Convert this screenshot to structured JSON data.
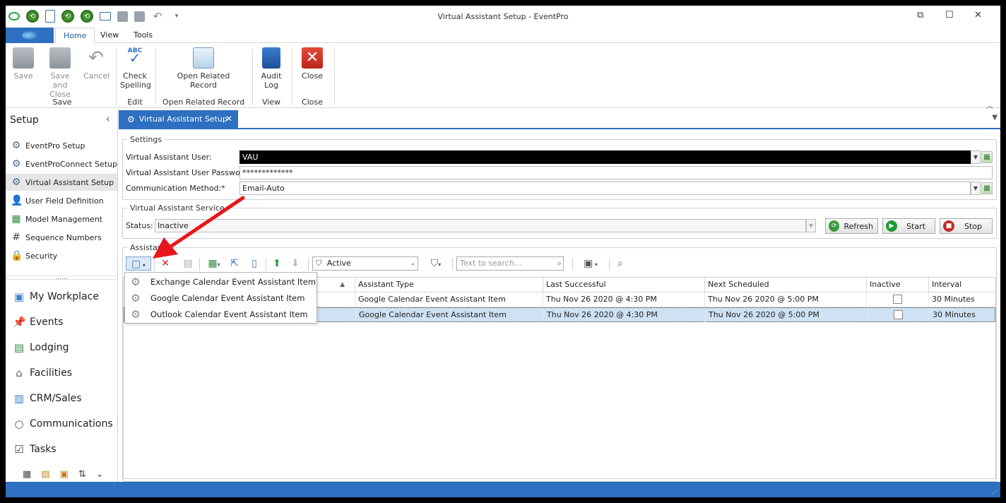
{
  "window": {
    "title": "Virtual Assistant Setup - EventPro"
  },
  "ribbon": {
    "tabs": [
      "Home",
      "View",
      "Tools"
    ],
    "buttons": {
      "save": "Save",
      "save_close": "Save and\nClose",
      "cancel": "Cancel",
      "check_spelling": "Check\nSpelling",
      "open_related": "Open Related\nRecord",
      "audit_log": "Audit\nLog",
      "close": "Close"
    },
    "groups": {
      "save": "Save",
      "edit": "Edit",
      "open_related": "Open Related Record",
      "view": "View",
      "close": "Close"
    },
    "check_icon_text": "ABC"
  },
  "sidebar": {
    "header": "Setup",
    "items": [
      "EventPro Setup",
      "EventProConnect Setup",
      "Virtual Assistant Setup",
      "User Field Definition",
      "Model Management",
      "Sequence Numbers",
      "Security"
    ],
    "splitter": "......",
    "nav": [
      "My Workplace",
      "Events",
      "Lodging",
      "Facilities",
      "CRM/Sales",
      "Communications",
      "Tasks"
    ]
  },
  "doc_tab": {
    "label": "Virtual Assistant Setup"
  },
  "settings": {
    "legend": "Settings",
    "user_label": "Virtual Assistant User:",
    "user_value": "VAU",
    "password_label": "Virtual Assistant User Password:",
    "password_value": "*************",
    "method_label": "Communication Method:*",
    "method_value": "Email-Auto"
  },
  "service": {
    "legend": "Virtual Assistant Service",
    "status_label": "Status:",
    "status_value": "Inactive",
    "refresh": "Refresh",
    "start": "Start",
    "stop": "Stop"
  },
  "assistants": {
    "legend": "Assistants",
    "filter_value": "Active",
    "search_placeholder": "Text to search...",
    "columns": [
      "Assistant Type",
      "Last Successful",
      "Next Scheduled",
      "Inactive",
      "Interval"
    ],
    "rows": [
      {
        "type": "Google Calendar Event Assistant Item",
        "last": "Thu Nov 26 2020 @ 4:30 PM",
        "next": "Thu Nov 26 2020 @ 5:00 PM",
        "interval": "30 Minutes"
      },
      {
        "type": "Google Calendar Event Assistant Item",
        "last": "Thu Nov 26 2020 @ 4:30 PM",
        "next": "Thu Nov 26 2020 @ 5:00 PM",
        "interval": "30 Minutes"
      }
    ],
    "new_menu": [
      "Exchange Calendar Event Assistant Item",
      "Google Calendar Event Assistant Item",
      "Outlook Calendar Event Assistant Item"
    ]
  },
  "colors": {
    "accent": "#2d6fc0",
    "arrow": "#e8161b",
    "selected_row": "#cfe2f3"
  },
  "icons": [
    "back-icon",
    "refresh-icon",
    "document-icon",
    "mail-icon",
    "save-icon",
    "undo-icon",
    "gear-icon",
    "filter-icon",
    "search-icon"
  ]
}
